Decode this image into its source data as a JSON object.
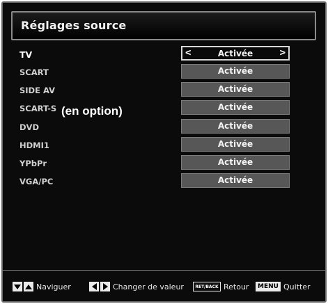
{
  "window": {
    "title": "Réglages source"
  },
  "rows": [
    {
      "label": "TV",
      "value": "Activée",
      "selected": true,
      "arrow_left": "<",
      "arrow_right": ">"
    },
    {
      "label": "SCART",
      "value": "Activée",
      "selected": false
    },
    {
      "label": "SIDE AV",
      "value": "Activée",
      "selected": false
    },
    {
      "label": "SCART-S",
      "value": "Activée",
      "selected": false
    },
    {
      "label": "DVD",
      "value": "Activée",
      "selected": false
    },
    {
      "label": "HDMI1",
      "value": "Activée",
      "selected": false
    },
    {
      "label": "YPbPr",
      "value": "Activée",
      "selected": false
    },
    {
      "label": "VGA/PC",
      "value": "Activée",
      "selected": false
    }
  ],
  "annotation": {
    "option_note": "(en option)"
  },
  "footer": {
    "navigate_label": "Naviguer",
    "change_value_label": "Changer de valeur",
    "return_key": "RET/BACK",
    "return_label": "Retour",
    "menu_key": "MENU",
    "quit_label": "Quitter",
    "icons": {
      "navigate": [
        "arrow-down-key-icon",
        "arrow-up-key-icon"
      ],
      "change_value": [
        "arrow-left-key-icon",
        "arrow-right-key-icon"
      ]
    }
  },
  "colors": {
    "background": "#0b0b0b",
    "value_box": "#575757",
    "selected_box_border": "#d8d8d8",
    "text": "#f4f4f4"
  }
}
